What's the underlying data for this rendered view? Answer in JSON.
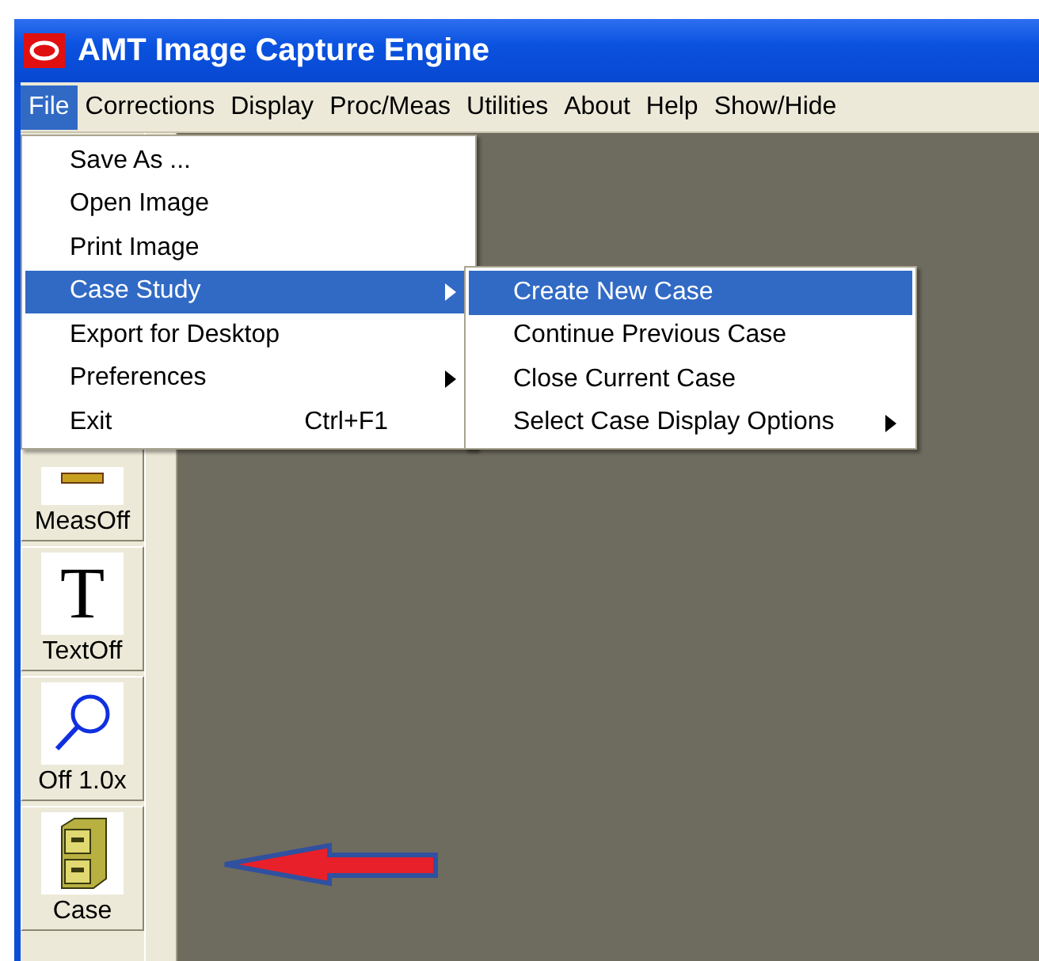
{
  "window": {
    "title": "AMT Image Capture Engine"
  },
  "menu_bar": [
    {
      "label": "File",
      "selected": true
    },
    {
      "label": "Corrections",
      "selected": false
    },
    {
      "label": "Display",
      "selected": false
    },
    {
      "label": "Proc/Meas",
      "selected": false
    },
    {
      "label": "Utilities",
      "selected": false
    },
    {
      "label": "About",
      "selected": false
    },
    {
      "label": "Help",
      "selected": false
    },
    {
      "label": "Show/Hide",
      "selected": false
    }
  ],
  "toolbar": [
    {
      "kind": "ruler",
      "label": "MeasOff"
    },
    {
      "kind": "text",
      "label": "TextOff",
      "glyph": "T"
    },
    {
      "kind": "zoom",
      "label": "Off 1.0x"
    },
    {
      "kind": "cabinet",
      "label": "Case"
    }
  ],
  "file_menu": {
    "items": [
      {
        "label": "Save As ...",
        "selected": false,
        "submenu": false
      },
      {
        "label": "Open Image",
        "selected": false,
        "submenu": false
      },
      {
        "label": "Print Image",
        "selected": false,
        "submenu": false
      },
      {
        "label": "Case Study",
        "selected": true,
        "submenu": true
      },
      {
        "label": "Export for Desktop",
        "selected": false,
        "submenu": false
      },
      {
        "label": "Preferences",
        "selected": false,
        "submenu": true
      },
      {
        "label": "Exit",
        "selected": false,
        "submenu": false,
        "shortcut": "Ctrl+F1"
      }
    ]
  },
  "case_study_menu": {
    "items": [
      {
        "label": "Create New Case",
        "selected": true,
        "submenu": false
      },
      {
        "label": "Continue Previous Case",
        "selected": false,
        "submenu": false
      },
      {
        "label": "Close Current Case",
        "selected": false,
        "submenu": false
      },
      {
        "label": "Select Case Display Options",
        "selected": false,
        "submenu": true
      }
    ]
  }
}
